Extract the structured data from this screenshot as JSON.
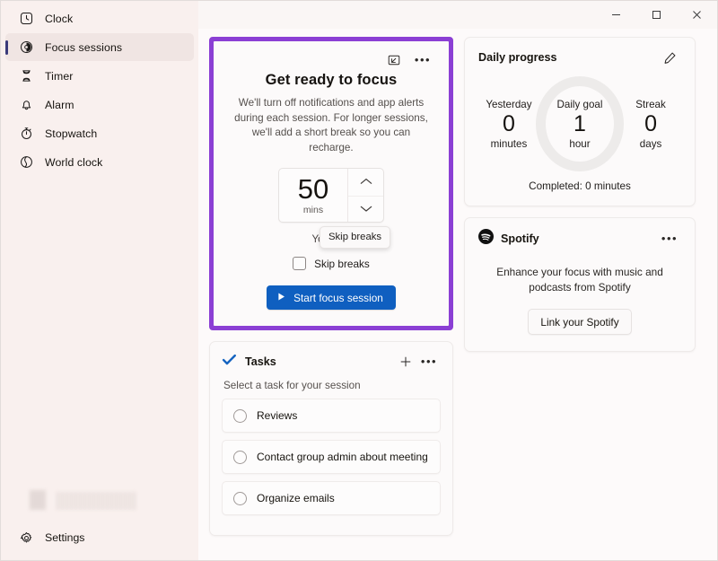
{
  "window": {
    "controls": {
      "minimize": "minimize-button",
      "maximize": "maximize-button",
      "close": "close-button"
    }
  },
  "sidebar": {
    "items": [
      {
        "label": "Clock",
        "icon": "clock-square-icon",
        "selected": false
      },
      {
        "label": "Focus sessions",
        "icon": "focus-sessions-icon",
        "selected": true
      },
      {
        "label": "Timer",
        "icon": "hourglass-icon",
        "selected": false
      },
      {
        "label": "Alarm",
        "icon": "bell-icon",
        "selected": false
      },
      {
        "label": "Stopwatch",
        "icon": "stopwatch-icon",
        "selected": false
      },
      {
        "label": "World clock",
        "icon": "globe-clock-icon",
        "selected": false
      }
    ],
    "settings": {
      "label": "Settings",
      "icon": "gear-icon"
    }
  },
  "focus_card": {
    "compact_icon": "compact-overlay-icon",
    "more_icon": "more-options-icon",
    "title": "Get ready to focus",
    "description": "We'll turn off notifications and app alerts during each session. For longer sessions, we'll add a short break so you can recharge.",
    "spinner": {
      "value": "50",
      "unit": "mins",
      "up_icon": "chevron-up-icon",
      "down_icon": "chevron-down-icon"
    },
    "youll_have_text": "You'll ha",
    "tooltip": "Skip breaks",
    "skip_breaks_label": "Skip breaks",
    "start_button": "Start focus session",
    "start_icon": "play-icon",
    "accent_border": "#8B3FD4",
    "button_color": "#0F5FC0"
  },
  "tasks_card": {
    "icon": "todo-check-icon",
    "title": "Tasks",
    "add_icon": "plus-icon",
    "more_icon": "more-options-icon",
    "subtitle": "Select a task for your session",
    "items": [
      {
        "label": "Reviews"
      },
      {
        "label": "Contact group admin about meeting"
      },
      {
        "label": "Organize emails"
      }
    ]
  },
  "progress_card": {
    "title": "Daily progress",
    "edit_icon": "pencil-edit-icon",
    "yesterday": {
      "caption": "Yesterday",
      "value": "0",
      "unit": "minutes"
    },
    "goal": {
      "caption": "Daily goal",
      "value": "1",
      "unit": "hour"
    },
    "streak": {
      "caption": "Streak",
      "value": "0",
      "unit": "days"
    },
    "completed": "Completed: 0 minutes",
    "ring_color": "#EDEBEA"
  },
  "spotify_card": {
    "icon": "spotify-icon",
    "title": "Spotify",
    "more_icon": "more-options-icon",
    "description": "Enhance your focus with music and podcasts from Spotify",
    "link_button": "Link your Spotify"
  }
}
